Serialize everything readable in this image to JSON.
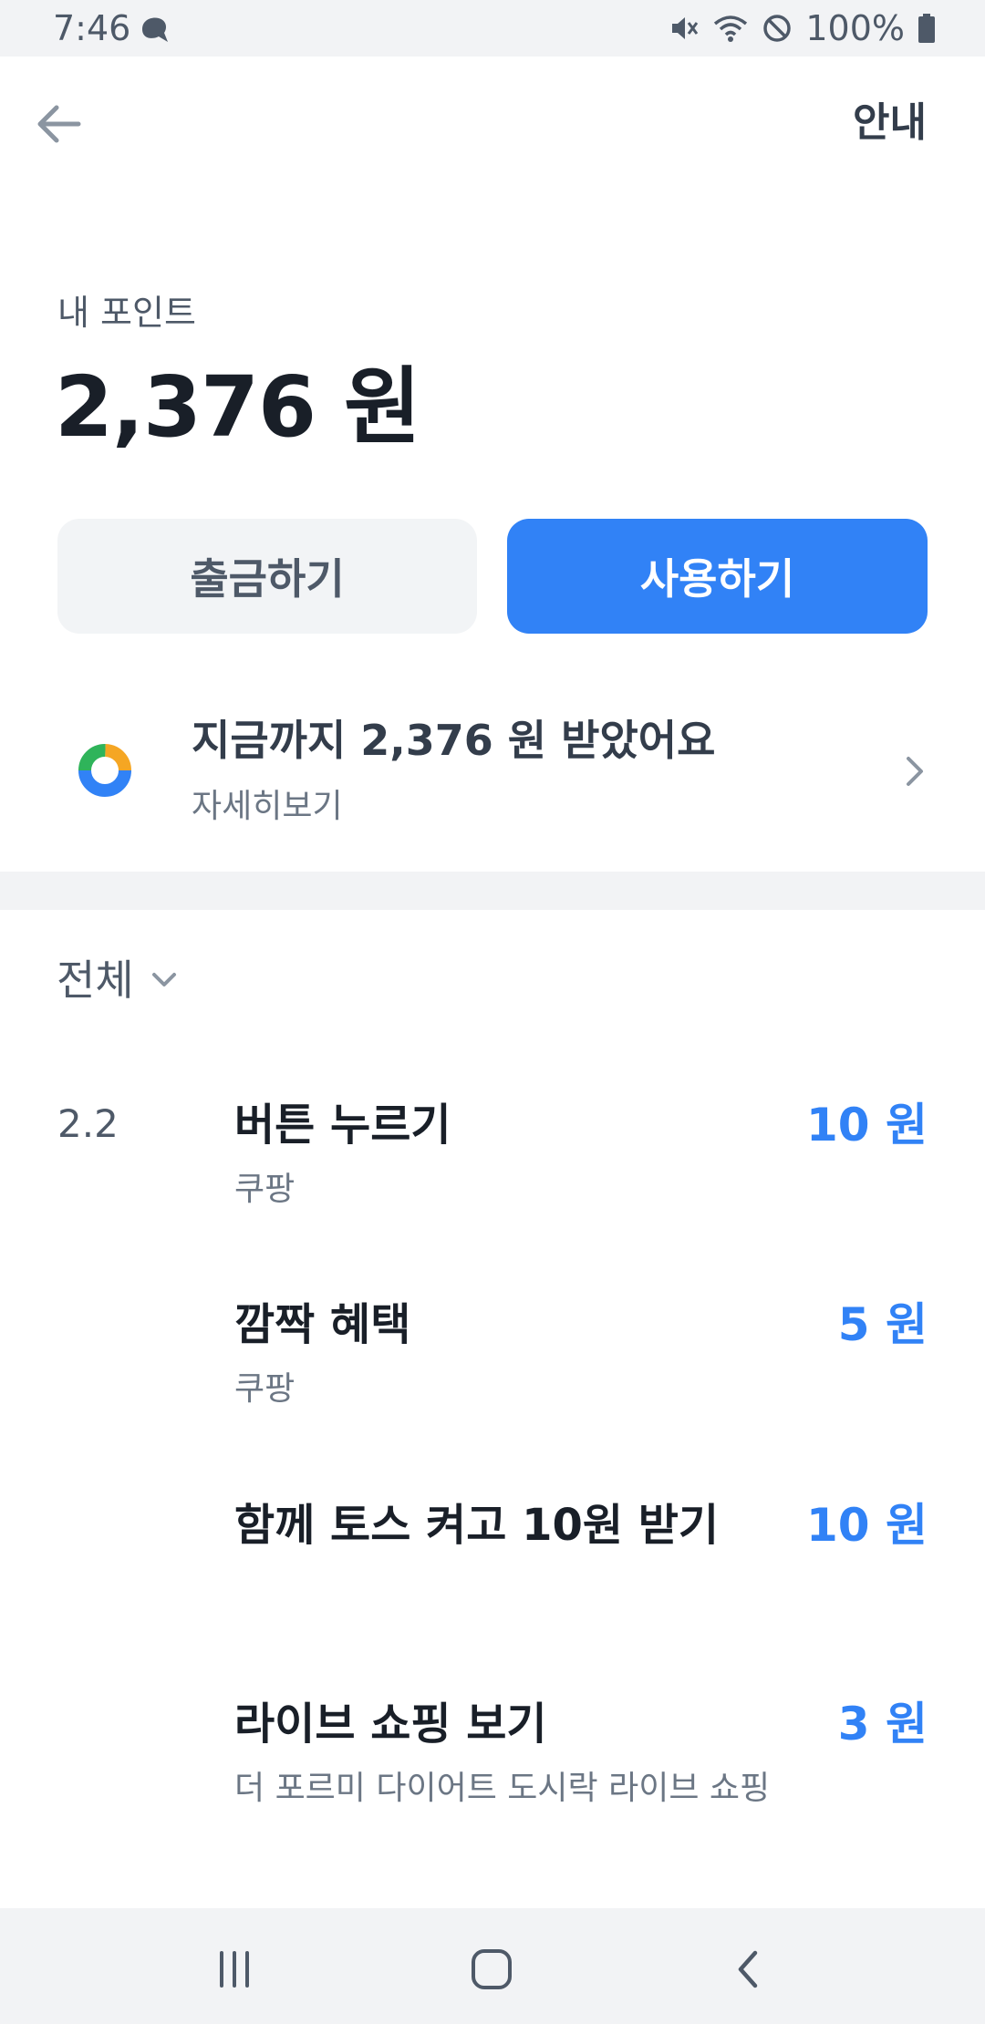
{
  "status_bar": {
    "time": "7:46",
    "battery": "100%"
  },
  "header": {
    "info_label": "안내"
  },
  "points": {
    "label": "내 포인트",
    "value": "2,376 원"
  },
  "buttons": {
    "withdraw": "출금하기",
    "use": "사용하기"
  },
  "earned": {
    "title": "지금까지 2,376 원 받았어요",
    "subtitle": "자세히보기"
  },
  "filter": {
    "label": "전체"
  },
  "history": {
    "date": "2.2",
    "items": [
      {
        "title": "버튼 누르기",
        "subtitle": "쿠팡",
        "amount": "10 원"
      },
      {
        "title": "깜짝 혜택",
        "subtitle": "쿠팡",
        "amount": "5 원"
      },
      {
        "title": "함께 토스 켜고 10원 받기",
        "subtitle": "",
        "amount": "10 원"
      },
      {
        "title": "라이브 쇼핑 보기",
        "subtitle": "더 포르미 다이어트 도시락 라이브 쇼핑",
        "amount": "3 원"
      }
    ]
  },
  "colors": {
    "accent": "#3182f6",
    "text_primary": "#191f28",
    "text_secondary": "#6b7684",
    "background_gray": "#f2f3f5"
  }
}
